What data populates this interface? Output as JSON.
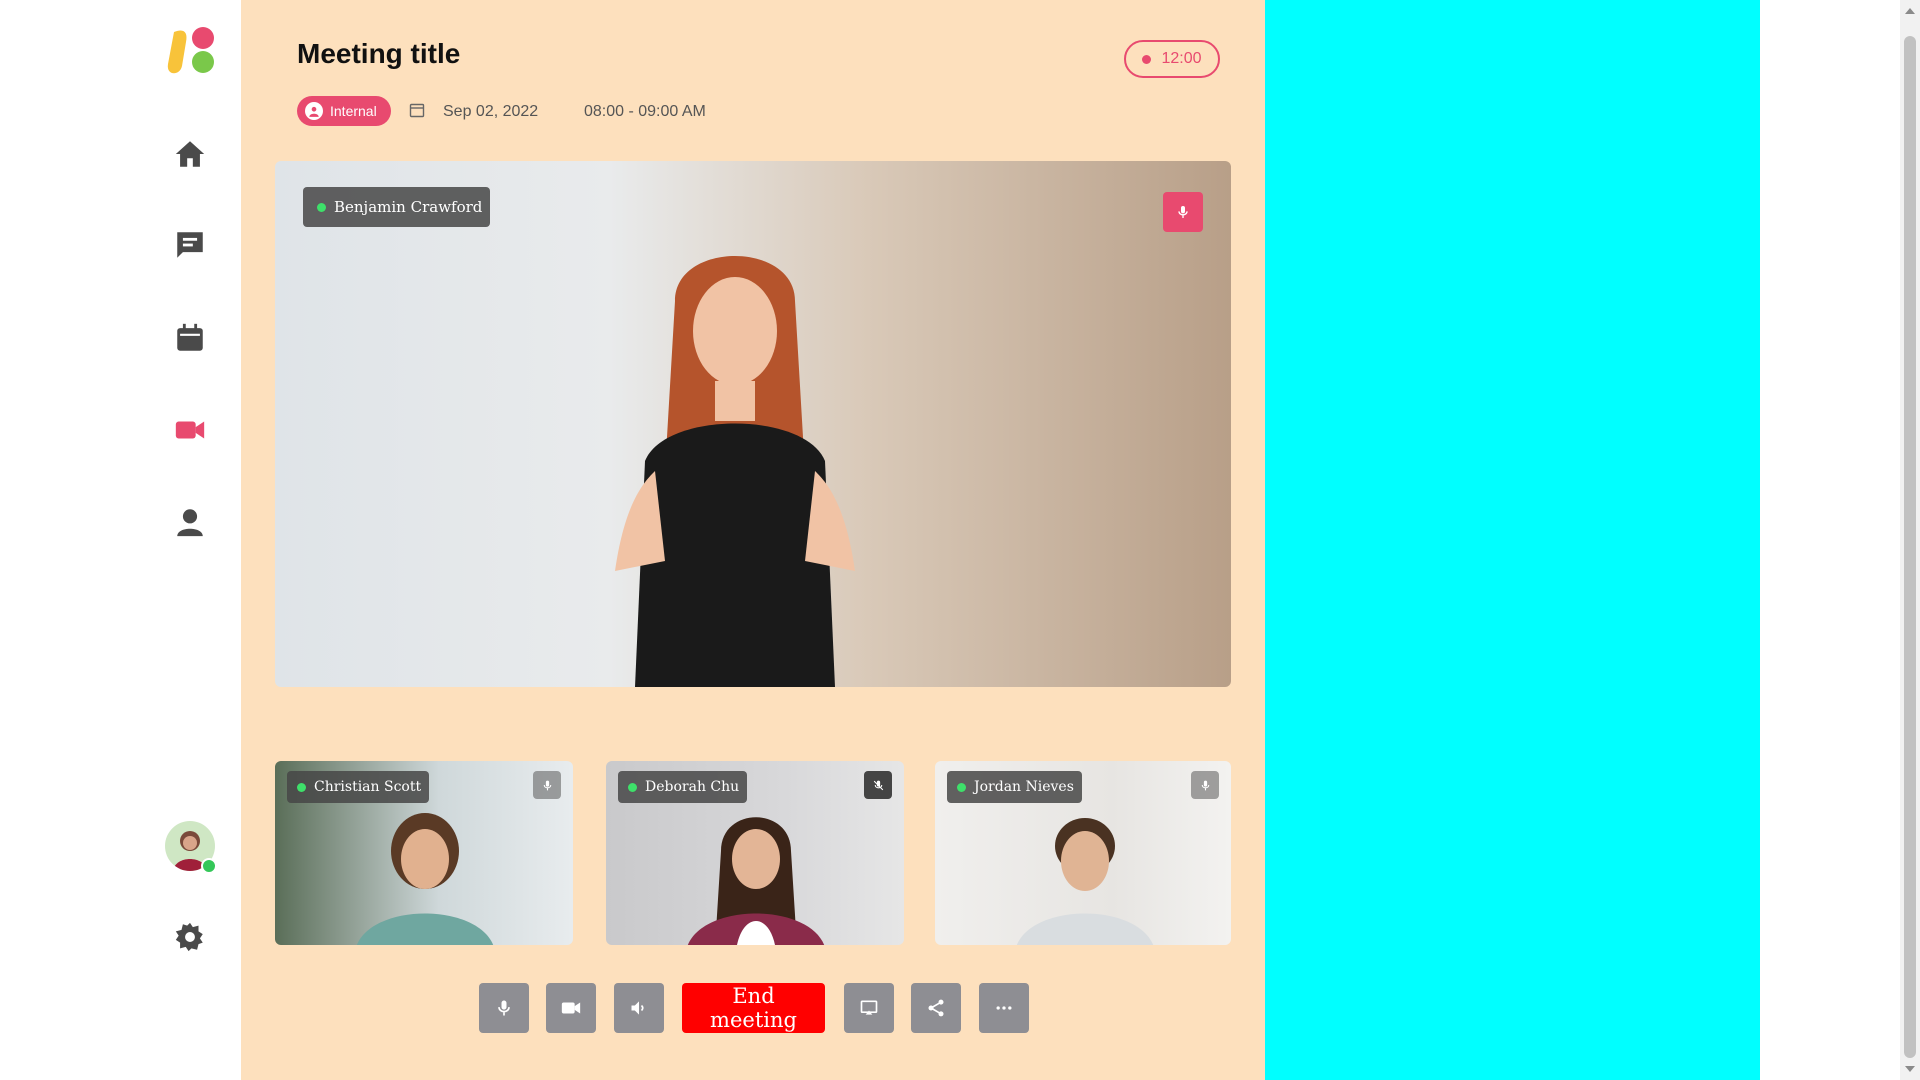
{
  "meeting": {
    "title": "Meeting title",
    "timer": "12:00",
    "badge": "Internal",
    "date": "Sep 02, 2022",
    "time": "08:00 - 09:00 AM"
  },
  "sidebar": {
    "items": [
      "home-icon",
      "chat-icon",
      "calendar-icon",
      "video-icon",
      "user-icon"
    ],
    "active": "video-icon",
    "settings_icon": "gear-icon"
  },
  "main_participant": {
    "name": "Benjamin Crawford",
    "mic": "on"
  },
  "participants": [
    {
      "name": "Christian Scott",
      "mic": "on"
    },
    {
      "name": "Deborah Chu",
      "mic": "muted"
    },
    {
      "name": "Jordan Nieves",
      "mic": "on"
    }
  ],
  "controls": {
    "end_meeting": "End meeting",
    "buttons": [
      "mic-icon",
      "camera-icon",
      "speaker-icon",
      "screen-share-icon",
      "share-icon",
      "more-icon"
    ]
  },
  "colors": {
    "accent": "#e84a6f",
    "main_bg": "#fde0bd",
    "right_panel": "#00ffff",
    "end_button": "#ff0000",
    "control_button": "#8e8e93"
  }
}
